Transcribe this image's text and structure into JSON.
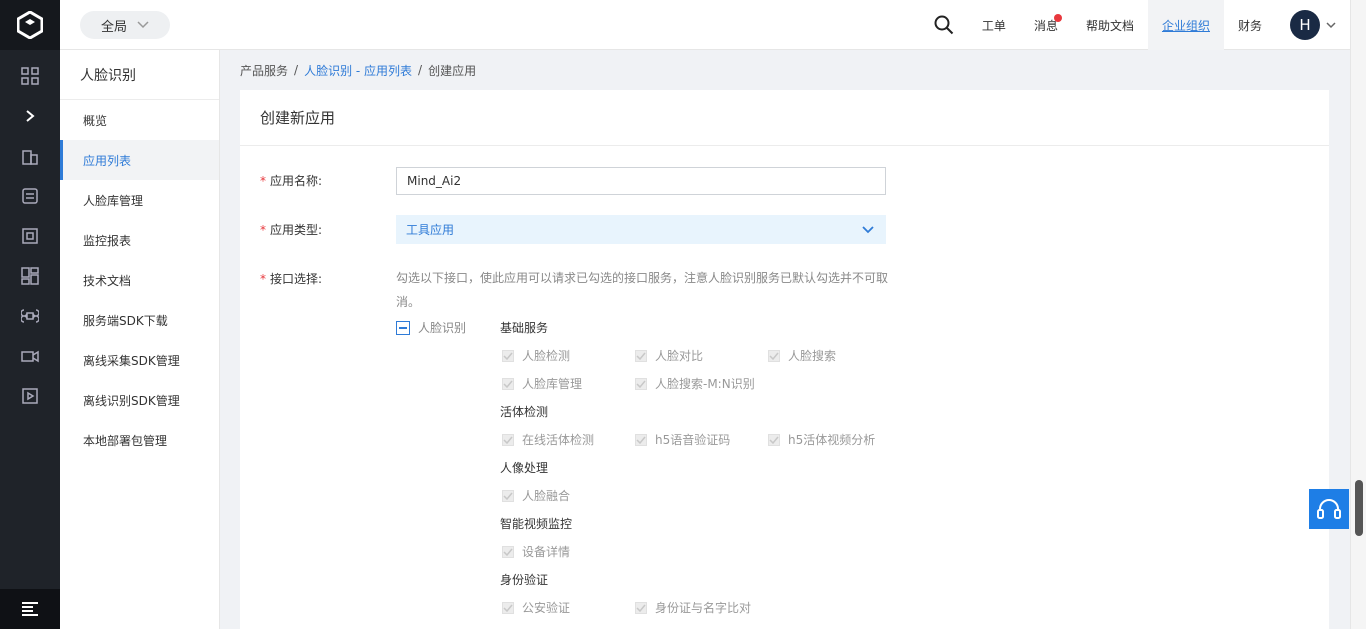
{
  "topbar": {
    "scope_label": "全局",
    "nav": [
      {
        "label": "工单"
      },
      {
        "label": "消息"
      },
      {
        "label": "帮助文档"
      },
      {
        "label": "企业组织"
      },
      {
        "label": "财务"
      }
    ],
    "avatar_initial": "H"
  },
  "sidebar": {
    "title": "人脸识别",
    "items": [
      {
        "label": "概览"
      },
      {
        "label": "应用列表"
      },
      {
        "label": "人脸库管理"
      },
      {
        "label": "监控报表"
      },
      {
        "label": "技术文档"
      },
      {
        "label": "服务端SDK下载"
      },
      {
        "label": "离线采集SDK管理"
      },
      {
        "label": "离线识别SDK管理"
      },
      {
        "label": "本地部署包管理"
      }
    ]
  },
  "breadcrumb": {
    "root": "产品服务",
    "sep": "/",
    "parent": "人脸识别 - 应用列表",
    "current": "创建应用"
  },
  "form": {
    "heading": "创建新应用",
    "name_label": "应用名称:",
    "name_value": "Mind_Ai2",
    "type_label": "应用类型:",
    "type_value": "工具应用",
    "api_label": "接口选择:",
    "api_hint": "勾选以下接口，使此应用可以请求已勾选的接口服务，注意人脸识别服务已默认勾选并不可取消。",
    "parent_group": "人脸识别",
    "groups": {
      "basic": {
        "title": "基础服务",
        "items": [
          "人脸检测",
          "人脸对比",
          "人脸搜索",
          "人脸库管理",
          "人脸搜索-M:N识别"
        ]
      },
      "liveness": {
        "title": "活体检测",
        "items": [
          "在线活体检测",
          "h5语音验证码",
          "h5活体视频分析"
        ]
      },
      "portrait": {
        "title": "人像处理",
        "items": [
          "人脸融合"
        ]
      },
      "video": {
        "title": "智能视频监控",
        "items": [
          "设备详情"
        ]
      },
      "identity": {
        "title": "身份验证",
        "items": [
          "公安验证",
          "身份证与名字比对"
        ]
      }
    }
  },
  "colors": {
    "accent": "#2f7bd7",
    "rail": "#1f2329",
    "required": "#e8383d",
    "help_button": "#1e7ee6"
  }
}
